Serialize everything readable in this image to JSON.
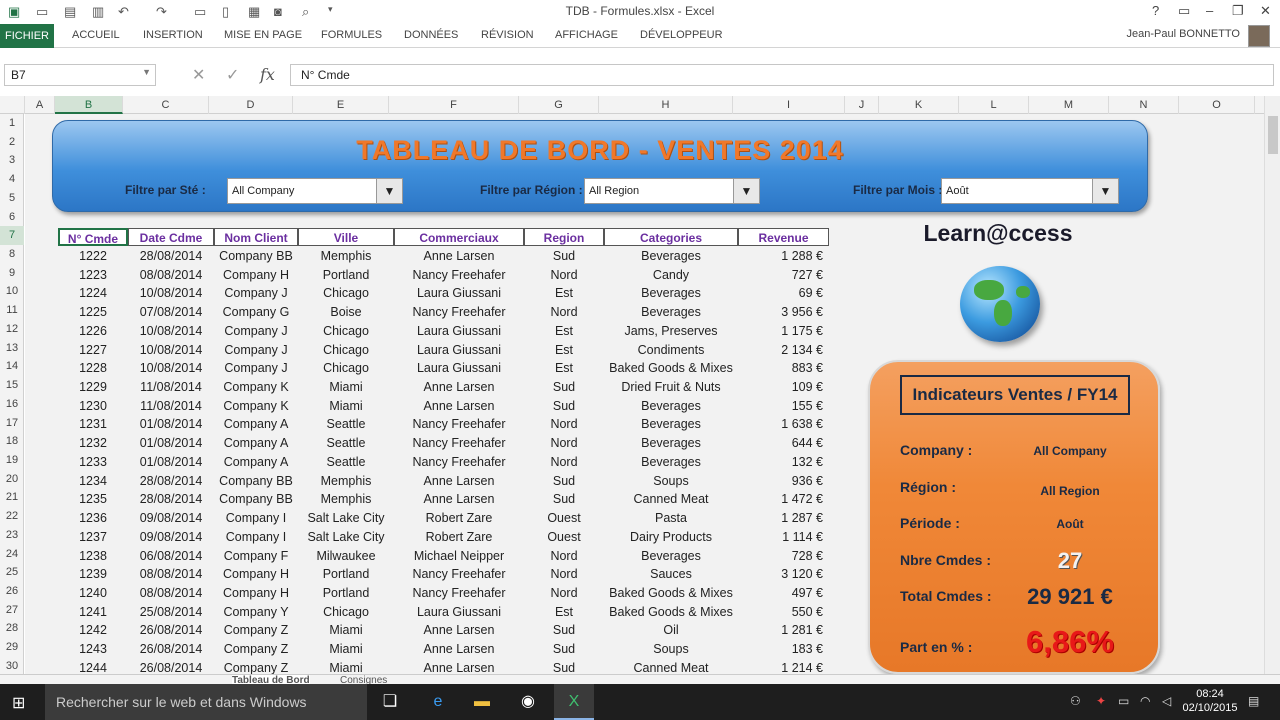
{
  "window": {
    "title": "TDB - Formules.xlsx - Excel",
    "controls": [
      "?",
      "▭",
      "–",
      "❐",
      "✕"
    ]
  },
  "ribbon": {
    "file": "FICHIER",
    "tabs": [
      "ACCUEIL",
      "INSERTION",
      "MISE EN PAGE",
      "FORMULES",
      "DONNÉES",
      "RÉVISION",
      "AFFICHAGE",
      "DÉVELOPPEUR"
    ],
    "user": "Jean-Paul BONNETTO"
  },
  "formula": {
    "namebox": "B7",
    "content": "N° Cmde",
    "fx": "fx"
  },
  "columns": [
    "A",
    "B",
    "C",
    "D",
    "E",
    "F",
    "G",
    "H",
    "I",
    "J",
    "K",
    "L",
    "M",
    "N",
    "O"
  ],
  "rows": [
    "1",
    "2",
    "3",
    "4",
    "5",
    "6",
    "7",
    "8",
    "9",
    "10",
    "11",
    "12",
    "13",
    "14",
    "15",
    "16",
    "17",
    "18",
    "19",
    "20",
    "21",
    "22",
    "23",
    "24",
    "25",
    "26",
    "27",
    "28",
    "29",
    "30"
  ],
  "dashboard": {
    "title": "TABLEAU DE BORD - VENTES 2014",
    "filters": [
      {
        "label": "Filtre par Sté :",
        "value": "All Company"
      },
      {
        "label": "Filtre par Région :",
        "value": "All Region"
      },
      {
        "label": "Filtre par Mois :",
        "value": "Août"
      }
    ],
    "brand": "Learn@ccess",
    "kpi": {
      "header": "Indicateurs Ventes / FY14",
      "company_label": "Company :",
      "company": "All Company",
      "region_label": "Région :",
      "region": "All Region",
      "periode_label": "Période :",
      "periode": "Août",
      "nbre_label": "Nbre Cmdes :",
      "nbre": "27",
      "total_label": "Total Cmdes :",
      "total": "29 921 €",
      "part_label": "Part en % :",
      "part": "6,86%"
    }
  },
  "table": {
    "headers": [
      "N° Cmde",
      "Date Cdme",
      "Nom Client",
      "Ville",
      "Commerciaux",
      "Region",
      "Categories",
      "Revenue"
    ],
    "rows": [
      [
        "1222",
        "28/08/2014",
        "Company BB",
        "Memphis",
        "Anne Larsen",
        "Sud",
        "Beverages",
        "1 288 €"
      ],
      [
        "1223",
        "08/08/2014",
        "Company H",
        "Portland",
        "Nancy Freehafer",
        "Nord",
        "Candy",
        "727 €"
      ],
      [
        "1224",
        "10/08/2014",
        "Company J",
        "Chicago",
        "Laura Giussani",
        "Est",
        "Beverages",
        "69 €"
      ],
      [
        "1225",
        "07/08/2014",
        "Company G",
        "Boise",
        "Nancy Freehafer",
        "Nord",
        "Beverages",
        "3 956 €"
      ],
      [
        "1226",
        "10/08/2014",
        "Company J",
        "Chicago",
        "Laura Giussani",
        "Est",
        "Jams, Preserves",
        "1 175 €"
      ],
      [
        "1227",
        "10/08/2014",
        "Company J",
        "Chicago",
        "Laura Giussani",
        "Est",
        "Condiments",
        "2 134 €"
      ],
      [
        "1228",
        "10/08/2014",
        "Company J",
        "Chicago",
        "Laura Giussani",
        "Est",
        "Baked Goods & Mixes",
        "883 €"
      ],
      [
        "1229",
        "11/08/2014",
        "Company K",
        "Miami",
        "Anne Larsen",
        "Sud",
        "Dried Fruit & Nuts",
        "109 €"
      ],
      [
        "1230",
        "11/08/2014",
        "Company K",
        "Miami",
        "Anne Larsen",
        "Sud",
        "Beverages",
        "155 €"
      ],
      [
        "1231",
        "01/08/2014",
        "Company A",
        "Seattle",
        "Nancy Freehafer",
        "Nord",
        "Beverages",
        "1 638 €"
      ],
      [
        "1232",
        "01/08/2014",
        "Company A",
        "Seattle",
        "Nancy Freehafer",
        "Nord",
        "Beverages",
        "644 €"
      ],
      [
        "1233",
        "01/08/2014",
        "Company A",
        "Seattle",
        "Nancy Freehafer",
        "Nord",
        "Beverages",
        "132 €"
      ],
      [
        "1234",
        "28/08/2014",
        "Company BB",
        "Memphis",
        "Anne Larsen",
        "Sud",
        "Soups",
        "936 €"
      ],
      [
        "1235",
        "28/08/2014",
        "Company BB",
        "Memphis",
        "Anne Larsen",
        "Sud",
        "Canned Meat",
        "1 472 €"
      ],
      [
        "1236",
        "09/08/2014",
        "Company I",
        "Salt Lake City",
        "Robert Zare",
        "Ouest",
        "Pasta",
        "1 287 €"
      ],
      [
        "1237",
        "09/08/2014",
        "Company I",
        "Salt Lake City",
        "Robert Zare",
        "Ouest",
        "Dairy Products",
        "1 114 €"
      ],
      [
        "1238",
        "06/08/2014",
        "Company F",
        "Milwaukee",
        "Michael Neipper",
        "Nord",
        "Beverages",
        "728 €"
      ],
      [
        "1239",
        "08/08/2014",
        "Company H",
        "Portland",
        "Nancy Freehafer",
        "Nord",
        "Sauces",
        "3 120 €"
      ],
      [
        "1240",
        "08/08/2014",
        "Company H",
        "Portland",
        "Nancy Freehafer",
        "Nord",
        "Baked Goods & Mixes",
        "497 €"
      ],
      [
        "1241",
        "25/08/2014",
        "Company Y",
        "Chicago",
        "Laura Giussani",
        "Est",
        "Baked Goods & Mixes",
        "550 €"
      ],
      [
        "1242",
        "26/08/2014",
        "Company Z",
        "Miami",
        "Anne Larsen",
        "Sud",
        "Oil",
        "1 281 €"
      ],
      [
        "1243",
        "26/08/2014",
        "Company Z",
        "Miami",
        "Anne Larsen",
        "Sud",
        "Soups",
        "183 €"
      ],
      [
        "1244",
        "26/08/2014",
        "Company Z",
        "Miami",
        "Anne Larsen",
        "Sud",
        "Canned Meat",
        "1 214 €"
      ]
    ]
  },
  "sheets": [
    "Tableau de Bord",
    "Consignes"
  ],
  "taskbar": {
    "search": "Rechercher sur le web et dans Windows",
    "time": "08:24",
    "date": "02/10/2015"
  }
}
